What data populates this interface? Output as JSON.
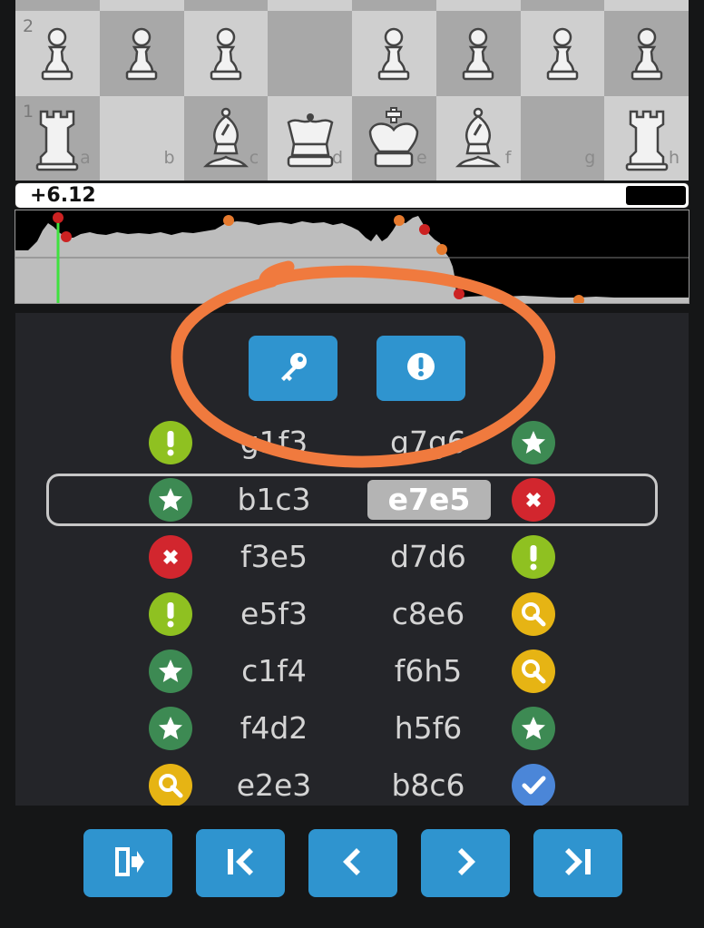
{
  "board": {
    "ranks": [
      {
        "label": "2",
        "squares": [
          "light",
          "dark",
          "light",
          "dark",
          "light",
          "dark",
          "light",
          "dark"
        ],
        "pieces": [
          "pawn",
          "pawn",
          "pawn",
          "",
          "pawn",
          "pawn",
          "pawn",
          "pawn"
        ]
      },
      {
        "label": "1",
        "squares": [
          "dark",
          "light",
          "dark",
          "light",
          "dark",
          "light",
          "dark",
          "light"
        ],
        "pieces": [
          "rook",
          "",
          "bishop",
          "queen",
          "king",
          "bishop",
          "",
          "rook"
        ]
      }
    ],
    "files": [
      "a",
      "b",
      "c",
      "d",
      "e",
      "f",
      "g",
      "h"
    ],
    "piece_color": "white"
  },
  "evaluation": {
    "score": "+6.12",
    "white_fraction": 0.91
  },
  "graph": {
    "type": "area",
    "description_colors": {
      "white_area": "#bdbdbd",
      "black_area": "#000000",
      "cursor": "#3fe23f",
      "marker_red": "#cc2222",
      "marker_orange": "#e67a2e"
    }
  },
  "tools": {
    "key_button": {
      "icon": "key-icon"
    },
    "alert_button": {
      "icon": "exclamation-icon"
    }
  },
  "moves": [
    {
      "white": "g1f3",
      "black": "g7g6",
      "white_badge": "good",
      "black_badge": "best"
    },
    {
      "white": "b1c3",
      "black": "e7e5",
      "white_badge": "best",
      "black_badge": "blunder",
      "current": true
    },
    {
      "white": "f3e5",
      "black": "d7d6",
      "white_badge": "blunder",
      "black_badge": "good"
    },
    {
      "white": "e5f3",
      "black": "c8e6",
      "white_badge": "good",
      "black_badge": "inaccuracy"
    },
    {
      "white": "c1f4",
      "black": "f6h5",
      "white_badge": "best",
      "black_badge": "inaccuracy"
    },
    {
      "white": "f4d2",
      "black": "h5f6",
      "white_badge": "best",
      "black_badge": "best"
    },
    {
      "white": "e2e3",
      "black": "b8c6",
      "white_badge": "inaccuracy",
      "black_badge": "book"
    }
  ],
  "badge_styles": {
    "good": {
      "icon": "exclamation-icon",
      "color": "#8fc121"
    },
    "best": {
      "icon": "star-icon",
      "color": "#3d8a53"
    },
    "blunder": {
      "icon": "cross-icon",
      "color": "#d2262e"
    },
    "inaccuracy": {
      "icon": "magnifier-icon",
      "color": "#e6b414"
    },
    "book": {
      "icon": "check-icon",
      "color": "#4b86d8"
    }
  },
  "navigation": {
    "buttons": [
      {
        "name": "exit-button",
        "icon": "exit-icon"
      },
      {
        "name": "first-move-button",
        "icon": "skip-first-icon"
      },
      {
        "name": "previous-move-button",
        "icon": "chevron-left-icon"
      },
      {
        "name": "next-move-button",
        "icon": "chevron-right-icon"
      },
      {
        "name": "last-move-button",
        "icon": "skip-last-icon"
      }
    ]
  },
  "accent": "#2f94cf"
}
